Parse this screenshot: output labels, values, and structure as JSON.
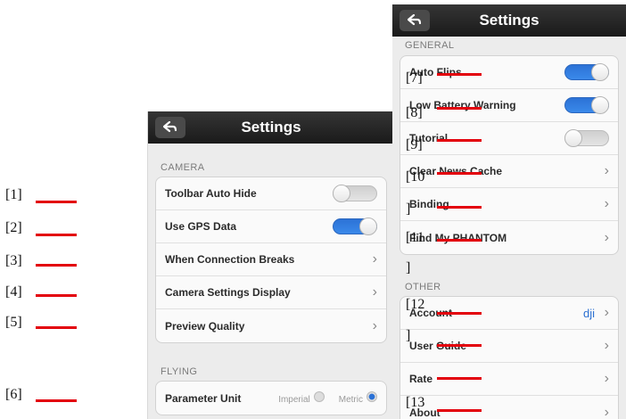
{
  "markers": [
    "[1]",
    "[2]",
    "[3]",
    "[4]",
    "[5]",
    "[6]",
    "[7]",
    "[8]",
    "[9]",
    "[10",
    "]",
    "[11",
    "]",
    "[12",
    "]",
    "[13"
  ],
  "left_phone": {
    "title": "Settings",
    "camera_section": "CAMERA",
    "camera_rows": [
      {
        "label": "Toolbar Auto Hide",
        "control": "toggle",
        "state": "off"
      },
      {
        "label": "Use GPS Data",
        "control": "toggle",
        "state": "on"
      },
      {
        "label": "When Connection Breaks",
        "control": "chevron"
      },
      {
        "label": "Camera Settings Display",
        "control": "chevron"
      },
      {
        "label": "Preview Quality",
        "control": "chevron"
      }
    ],
    "flying_section": "FLYING",
    "parameter_unit": {
      "label": "Parameter Unit",
      "option_imperial": "Imperial",
      "option_metric": "Metric",
      "selected": "Metric"
    }
  },
  "right_phone": {
    "title": "Settings",
    "general_section": "GENERAL",
    "general_rows": [
      {
        "label": "Auto Flips",
        "control": "toggle",
        "state": "on"
      },
      {
        "label": "Low Battery Warning",
        "control": "toggle",
        "state": "on"
      },
      {
        "label": "Tutorial",
        "control": "toggle",
        "state": "off"
      },
      {
        "label": "Clear News Cache",
        "control": "chevron"
      },
      {
        "label": "Binding",
        "control": "chevron"
      },
      {
        "label": "Find My PHANTOM",
        "control": "chevron"
      }
    ],
    "other_section": "OTHER",
    "other_rows": [
      {
        "label": "Account",
        "value": "dji",
        "control": "chevron"
      },
      {
        "label": "User Guide",
        "control": "chevron"
      },
      {
        "label": "Rate",
        "control": "chevron"
      },
      {
        "label": "About",
        "control": "chevron"
      }
    ]
  },
  "icons": {
    "back": "back-arrow-icon",
    "chevron": "chevron-right-icon"
  },
  "colors": {
    "accent": "#2c72d6",
    "marker_line": "#e3000b",
    "navbar": "#1f1f1f"
  }
}
